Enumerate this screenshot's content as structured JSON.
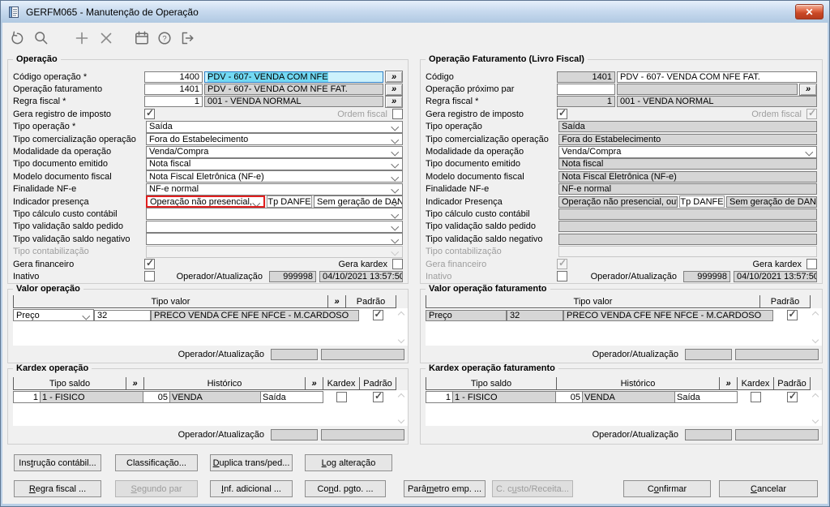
{
  "ui": {
    "more": "»",
    "close": "✕"
  },
  "window": {
    "title": "GERFM065 - Manutenção de Operação"
  },
  "toolbar": {
    "icons": [
      "undo",
      "search",
      "add",
      "delete",
      "calendar",
      "help",
      "exit"
    ]
  },
  "left": {
    "title": "Operação",
    "codigo": {
      "label": "Código operação *",
      "num": "1400",
      "desc": "PDV - 607- VENDA COM NFE"
    },
    "faturamento": {
      "label": "Operação faturamento",
      "num": "1401",
      "desc": "PDV - 607- VENDA COM NFE FAT."
    },
    "regra": {
      "label": "Regra fiscal *",
      "num": "1",
      "desc": "001 - VENDA NORMAL"
    },
    "imposto": {
      "label": "Gera registro de imposto",
      "checked": true,
      "ordem_label": "Ordem fiscal",
      "ordem_checked": false
    },
    "tipo_operacao": {
      "label": "Tipo operação *",
      "value": "Saída"
    },
    "comercializacao": {
      "label": "Tipo comercialização operação",
      "value": "Fora do Estabelecimento"
    },
    "modalidade": {
      "label": "Modalidade da operação",
      "value": "Venda/Compra"
    },
    "doc_emitido": {
      "label": "Tipo documento emitido",
      "value": "Nota fiscal"
    },
    "modelo_fiscal": {
      "label": "Modelo documento fiscal",
      "value": "Nota Fiscal Eletrônica (NF-e)"
    },
    "finalidade": {
      "label": "Finalidade NF-e",
      "value": "NF-e normal"
    },
    "indicador": {
      "label": "Indicador presença",
      "value": "Operação não presencial,",
      "danfe_label": "Tp DANFE",
      "danfe_value": "Sem geração de DAN"
    },
    "custo_contabil": {
      "label": "Tipo cálculo custo contábil",
      "value": ""
    },
    "saldo_pedido": {
      "label": "Tipo validação saldo pedido",
      "value": ""
    },
    "saldo_negativo": {
      "label": "Tipo validação saldo negativo",
      "value": ""
    },
    "contabilizacao": {
      "label": "Tipo contabilização",
      "value": ""
    },
    "financeiro": {
      "label": "Gera financeiro",
      "checked": true,
      "kardex_label": "Gera kardex",
      "kardex_checked": false
    },
    "inativo": {
      "label": "Inativo",
      "checked": false,
      "oper_label": "Operador/Atualização",
      "oper_num": "999998",
      "oper_date": "04/10/2021 13:57:50"
    }
  },
  "right": {
    "title": "Operação Faturamento (Livro Fiscal)",
    "codigo": {
      "label": "Código",
      "num": "1401",
      "desc": "PDV - 607- VENDA COM NFE FAT."
    },
    "proximo": {
      "label": "Operação próximo par",
      "num": "",
      "desc": ""
    },
    "regra": {
      "label": "Regra fiscal *",
      "num": "1",
      "desc": "001 - VENDA NORMAL"
    },
    "imposto": {
      "label": "Gera registro de imposto",
      "checked": true,
      "ordem_label": "Ordem fiscal",
      "ordem_checked": true
    },
    "tipo_operacao": {
      "label": "Tipo operação",
      "value": "Saída"
    },
    "comercializacao": {
      "label": "Tipo comercialização operação",
      "value": "Fora do Estabelecimento"
    },
    "modalidade": {
      "label": "Modalidade da operação",
      "value": "Venda/Compra"
    },
    "doc_emitido": {
      "label": "Tipo documento emitido",
      "value": "Nota fiscal"
    },
    "modelo_fiscal": {
      "label": "Modelo documento fiscal",
      "value": "Nota Fiscal Eletrônica (NF-e)"
    },
    "finalidade": {
      "label": "Finalidade NF-e",
      "value": "NF-e normal"
    },
    "indicador": {
      "label": "Indicador Presença",
      "value": "Operação não presencial, out",
      "danfe_label": "Tp DANFE",
      "danfe_value": "Sem geração de DANFE"
    },
    "custo_contabil": {
      "label": "Tipo cálculo custo contábil",
      "value": ""
    },
    "saldo_pedido": {
      "label": "Tipo validação saldo pedido",
      "value": ""
    },
    "saldo_negativo": {
      "label": "Tipo validação saldo negativo",
      "value": ""
    },
    "contabilizacao": {
      "label": "Tipo contabilização",
      "value": ""
    },
    "financeiro": {
      "label": "Gera financeiro",
      "checked": true,
      "kardex_label": "Gera kardex",
      "kardex_checked": false
    },
    "inativo": {
      "label": "Inativo",
      "checked": false,
      "oper_label": "Operador/Atualização",
      "oper_num": "999998",
      "oper_date": "04/10/2021 13:57:50"
    }
  },
  "valor_op": {
    "title": "Valor operação",
    "col_tipo_valor": "Tipo valor",
    "col_padrao": "Padrão",
    "row": {
      "tipo": "Preço",
      "num": "32",
      "desc": "PRECO VENDA CFE NFE NFCE - M.CARDOSO",
      "padrao_checked": true
    },
    "oper_label": "Operador/Atualização"
  },
  "valor_fat": {
    "title": "Valor operação faturamento",
    "col_tipo_valor": "Tipo valor",
    "col_padrao": "Padrão",
    "row": {
      "tipo": "Preço",
      "num": "32",
      "desc": "PRECO VENDA CFE NFE NFCE - M.CARDOSO",
      "padrao_checked": true
    },
    "oper_label": "Operador/Atualização"
  },
  "kardex_op": {
    "title": "Kardex operação",
    "col_tipo_saldo": "Tipo saldo",
    "col_historico": "Histórico",
    "col_kardex": "Kardex",
    "col_padrao": "Padrão",
    "row": {
      "num": "1",
      "saldo": "1 - FISICO",
      "hist_num": "05",
      "historico": "VENDA",
      "tipo": "Saída",
      "kardex_checked": false,
      "padrao_checked": true
    },
    "oper_label": "Operador/Atualização"
  },
  "kardex_fat": {
    "title": "Kardex operação faturamento",
    "col_tipo_saldo": "Tipo saldo",
    "col_historico": "Histórico",
    "col_kardex": "Kardex",
    "col_padrao": "Padrão",
    "row": {
      "num": "1",
      "saldo": "1 - FISICO",
      "hist_num": "05",
      "historico": "VENDA",
      "tipo": "Saída",
      "kardex_checked": false,
      "padrao_checked": true
    },
    "oper_label": "Operador/Atualização"
  },
  "buttons": {
    "r1": [
      {
        "t": "Instrução contábil...",
        "u": 3
      },
      {
        "t": "Classificação...",
        "u": -1
      },
      {
        "t": "Duplica trans/ped...",
        "u": 0
      },
      {
        "t": "Log alteração",
        "u": 0
      }
    ],
    "r2": [
      {
        "t": "Regra fiscal ...",
        "u": 0
      },
      {
        "t": "Segundo par",
        "u": 0,
        "disabled": true
      },
      {
        "t": "Inf. adicional ...",
        "u": 0
      },
      {
        "t": "Cond. pgto. ...",
        "u": 2
      },
      {
        "t": "Parâmetro emp. ...",
        "u": 4
      },
      {
        "t": "C. custo/Receita...",
        "u": 4,
        "disabled": true
      }
    ],
    "confirm": {
      "t": "Confirmar",
      "u": 1
    },
    "cancel": {
      "t": "Cancelar",
      "u": 0
    }
  }
}
